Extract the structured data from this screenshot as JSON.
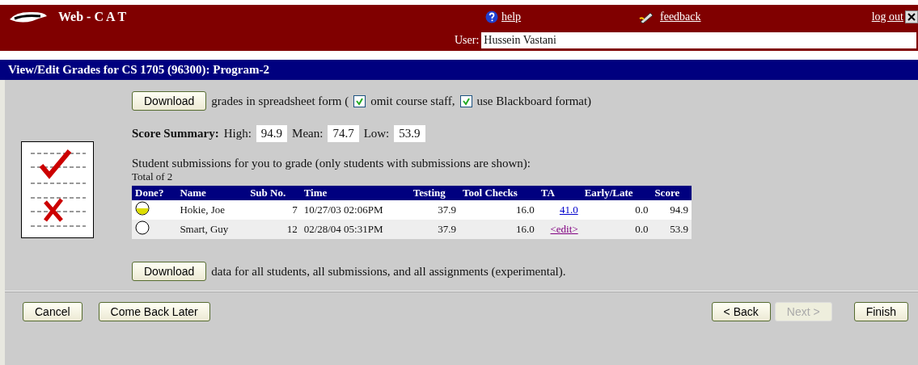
{
  "header": {
    "app_name": "Web - C A T",
    "help": "help",
    "feedback": "feedback",
    "logout": "log out",
    "user_label": "User:",
    "user_name": "Hussein Vastani"
  },
  "title": "View/Edit Grades for CS 1705 (96300): Program-2",
  "download_grades": {
    "button": "Download",
    "text_before": "grades in spreadsheet form (",
    "options": [
      {
        "label": "omit course staff,",
        "checked": true
      },
      {
        "label": "use Blackboard format)",
        "checked": true
      }
    ]
  },
  "score_summary": {
    "label": "Score Summary:",
    "items": [
      {
        "label": "High:",
        "value": "94.9"
      },
      {
        "label": "Mean:",
        "value": "74.7"
      },
      {
        "label": "Low:",
        "value": "53.9"
      }
    ]
  },
  "submissions_note": "Student submissions for you to grade (only students with submissions are shown):",
  "total": "Total of 2",
  "table": {
    "columns": [
      "Done?",
      "Name",
      "Sub No.",
      "Time",
      "Testing",
      "Tool Checks",
      "TA",
      "Early/Late",
      "Score"
    ],
    "rows": [
      {
        "done": true,
        "name": "Hokie, Joe",
        "sub_no": "7",
        "time": "10/27/03 02:06PM",
        "testing": "37.9",
        "tool_checks": "16.0",
        "ta": "41.0",
        "ta_visited": false,
        "early_late": "0.0",
        "score": "94.9"
      },
      {
        "done": false,
        "name": "Smart, Guy",
        "sub_no": "12",
        "time": "02/28/04 05:31PM",
        "testing": "37.9",
        "tool_checks": "16.0",
        "ta": "<edit>",
        "ta_visited": true,
        "early_late": "0.0",
        "score": "53.9"
      }
    ]
  },
  "download_all": {
    "button": "Download",
    "text": "data for all students, all submissions, and all assignments (experimental)."
  },
  "footer": {
    "left_buttons": [
      {
        "label": "Cancel",
        "disabled": false
      },
      {
        "label": "Come Back Later",
        "disabled": false
      }
    ],
    "right_buttons": [
      {
        "label": "< Back",
        "disabled": false
      },
      {
        "label": "Next >",
        "disabled": true
      },
      {
        "label": "Finish",
        "disabled": false
      }
    ]
  }
}
